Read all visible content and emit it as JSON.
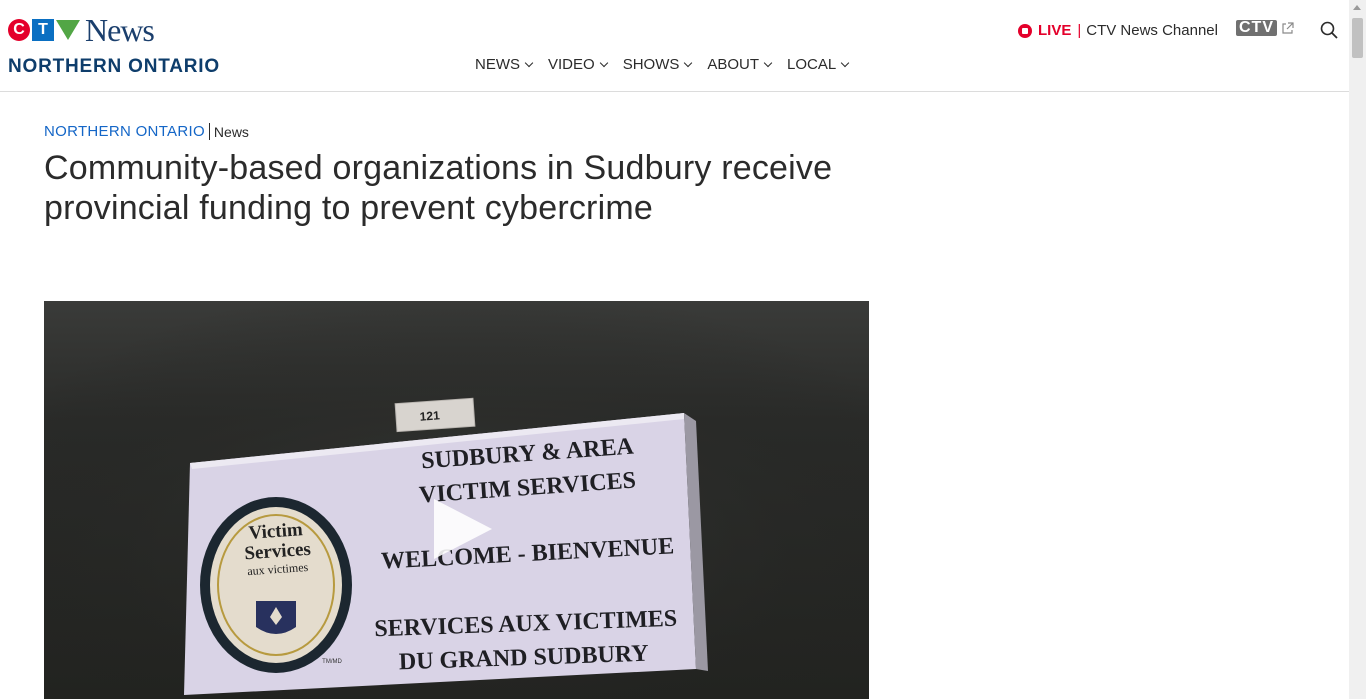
{
  "header": {
    "logo": {
      "letters": [
        "C",
        "T",
        "V"
      ],
      "word": "News"
    },
    "region_title": "NORTHERN ONTARIO",
    "nav": [
      {
        "label": "NEWS"
      },
      {
        "label": "VIDEO"
      },
      {
        "label": "SHOWS"
      },
      {
        "label": "ABOUT"
      },
      {
        "label": "LOCAL"
      }
    ],
    "live": {
      "label": "LIVE",
      "separator": "|",
      "channel": "CTV News Channel"
    },
    "ctv_link": {
      "label": "CTV",
      "icon": "external-link-icon"
    },
    "search_icon": "search-icon"
  },
  "article": {
    "breadcrumb": {
      "region": "NORTHERN ONTARIO",
      "section": "News"
    },
    "headline": "Community-based organizations in Sudbury receive provincial funding to prevent cybercrime",
    "video": {
      "play_icon": "play-icon",
      "sign": {
        "room_number": "121",
        "seal_line1": "Victim",
        "seal_line2": "Services",
        "seal_line3": "aux victimes",
        "line1": "SUDBURY & AREA",
        "line2": "VICTIM SERVICES",
        "line3": "WELCOME - BIENVENUE",
        "line4": "SERVICES AUX VICTIMES",
        "line5": "DU GRAND SUDBURY",
        "mark": "TM/MD"
      }
    }
  },
  "colors": {
    "brand_red": "#e4002b",
    "brand_blue": "#0a6fc2",
    "brand_green": "#52a645",
    "region_navy": "#0e3d6b",
    "link_blue": "#1466c7"
  }
}
